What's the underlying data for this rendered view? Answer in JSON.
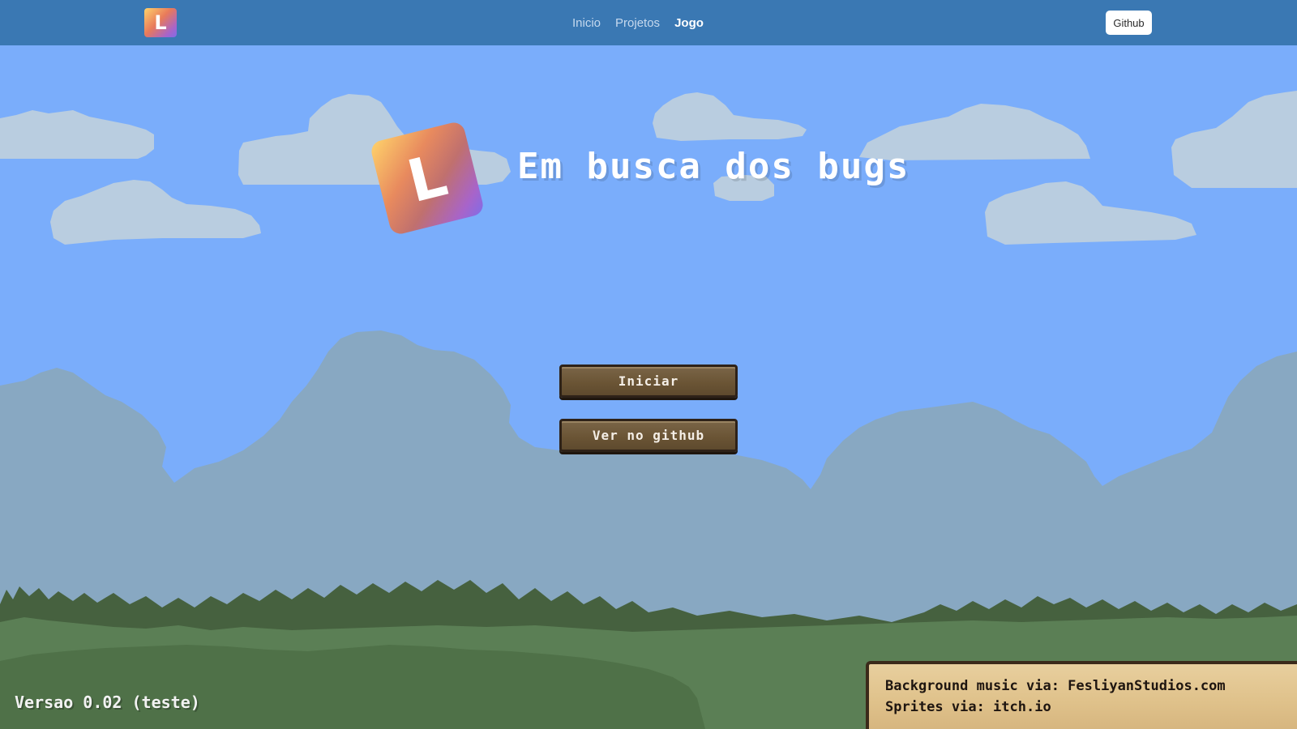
{
  "nav": {
    "logo_letter": "L",
    "links": [
      {
        "label": "Inicio",
        "active": false
      },
      {
        "label": "Projetos",
        "active": false
      },
      {
        "label": "Jogo",
        "active": true
      }
    ],
    "github_label": "Github"
  },
  "game": {
    "logo_letter": "L",
    "title": "Em busca dos bugs",
    "buttons": {
      "start": "Iniciar",
      "github": "Ver no github"
    },
    "version": "Versao 0.02 (teste)",
    "credits": {
      "music": "Background music via: FesliyanStudios.com",
      "sprites": "Sprites via: itch.io"
    }
  },
  "colors": {
    "navbar": "#3a78b3",
    "sky": "#7aadfb",
    "far_clouds": "#88a8c2",
    "near_clouds": "#b9cde0",
    "grass_light": "#5b7f55",
    "grass_dark": "#46613f",
    "wood_button": "#6b5535",
    "plank": "#dfc18a"
  }
}
